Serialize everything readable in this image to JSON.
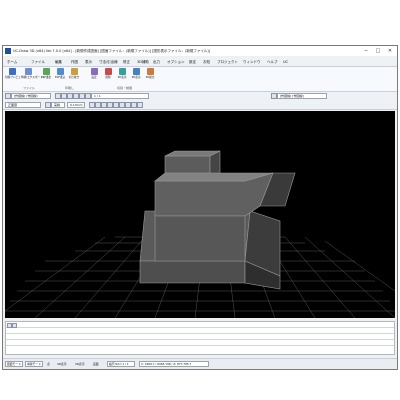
{
  "window": {
    "title": "UC-Draw 3D (x64) Ver.7.0.0 [x64] - [新規作成図面] [図面ファイル：(新規ファイル)] [図形表示ファイル：(新規ファイル)]",
    "minimize": "─",
    "maximize": "□",
    "close": "✕"
  },
  "menu": [
    "ホーム",
    "ファイル",
    "編集",
    "作図",
    "表示",
    "寸法/引出線",
    "修正",
    "3D補助",
    "出力",
    "オプション",
    "設定",
    "お知",
    "プロジェクト",
    "ウィンドウ",
    "ヘルプ",
    "UC"
  ],
  "ribbon": {
    "buttons": [
      {
        "label": "印刷プレビュー",
        "color": "#3c6fc4"
      },
      {
        "label": "印刷(エクスポート)",
        "color": "#6a8fd0"
      },
      {
        "label": "DXF書出",
        "color": "#5aa55a"
      },
      {
        "label": "DXF書込",
        "color": "#4e8ecf"
      },
      {
        "label": "切り抜き",
        "color": "#c8a040"
      },
      {
        "label": "設定",
        "color": "#8a6abf"
      },
      {
        "label": "削除",
        "color": "#c94a4a"
      },
      {
        "label": "3D表示",
        "color": "#3a9ea0"
      },
      {
        "label": "3D表示",
        "color": "#4a80c0"
      },
      {
        "label": "3D組立",
        "color": "#cf7a3a"
      }
    ],
    "groups": [
      "ファイル",
      "印刷し",
      "切替・制御"
    ]
  },
  "toolbar": {
    "layer_combo": "[作図線]  (作図線)",
    "pen_combo": "実線",
    "width_combo": "0.13mm",
    "scale_combo": "1 / 1",
    "style_combo": "[作図線] [作図線]",
    "view_combo": "正面図"
  },
  "bottom_panel": {
    "rows": [
      "",
      "",
      ""
    ]
  },
  "status": {
    "mode": "図面モード",
    "select": "単線モード",
    "snap": "点",
    "items": [
      "3D表示",
      "3D表示",
      "画面"
    ],
    "ratio": "縮尺(S/U) 1 / 1",
    "coords": "X: 1989,7 / 0965,798 / Z: 877,785.7"
  },
  "colors": {
    "accent": "#2455a4",
    "viewport_bg": "#000000",
    "grid": "#7a7a7a"
  }
}
